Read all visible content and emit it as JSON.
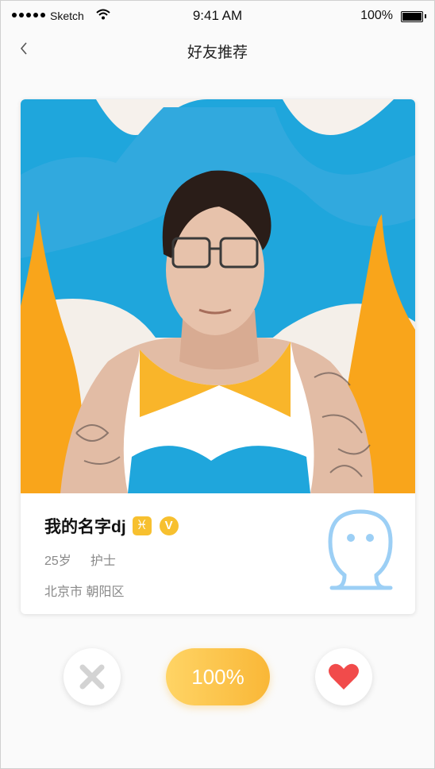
{
  "status_bar": {
    "carrier": "Sketch",
    "time": "9:41 AM",
    "battery": "100%"
  },
  "nav": {
    "title": "好友推荐"
  },
  "profile": {
    "name": "我的名字dj",
    "zodiac_symbol": "♓",
    "verified_symbol": "V",
    "age": "25岁",
    "occupation": "护士",
    "location": "北京市 朝阳区"
  },
  "actions": {
    "match_label": "100%",
    "dislike_icon": "close-icon",
    "like_icon": "heart-icon"
  },
  "colors": {
    "accent": "#f7c02f",
    "ghost": "#9ccff5",
    "heart": "#f14b4b",
    "x": "#d3d3d3"
  }
}
